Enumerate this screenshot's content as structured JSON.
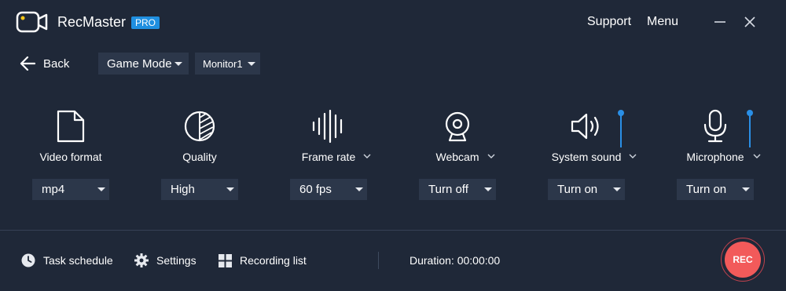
{
  "app": {
    "name": "RecMaster",
    "badge": "PRO"
  },
  "header": {
    "support": "Support",
    "menu": "Menu"
  },
  "toolbar": {
    "back": "Back",
    "mode": "Game Mode",
    "monitor": "Monitor1"
  },
  "features": [
    {
      "label": "Video format",
      "value": "mp4",
      "icon": "file-icon"
    },
    {
      "label": "Quality",
      "value": "High",
      "icon": "quality-icon"
    },
    {
      "label": "Frame rate",
      "value": "60 fps",
      "icon": "waveform-icon"
    },
    {
      "label": "Webcam",
      "value": "Turn off",
      "icon": "webcam-icon"
    },
    {
      "label": "System sound",
      "value": "Turn on",
      "icon": "speaker-icon"
    },
    {
      "label": "Microphone",
      "value": "Turn on",
      "icon": "microphone-icon"
    }
  ],
  "bottom": {
    "task_schedule": "Task schedule",
    "settings": "Settings",
    "recording_list": "Recording list",
    "duration": "Duration: 00:00:00",
    "rec": "REC"
  },
  "colors": {
    "background": "#1f2838",
    "control": "#2c374a",
    "accent": "#1f8fe0",
    "record": "#f25a5a"
  }
}
